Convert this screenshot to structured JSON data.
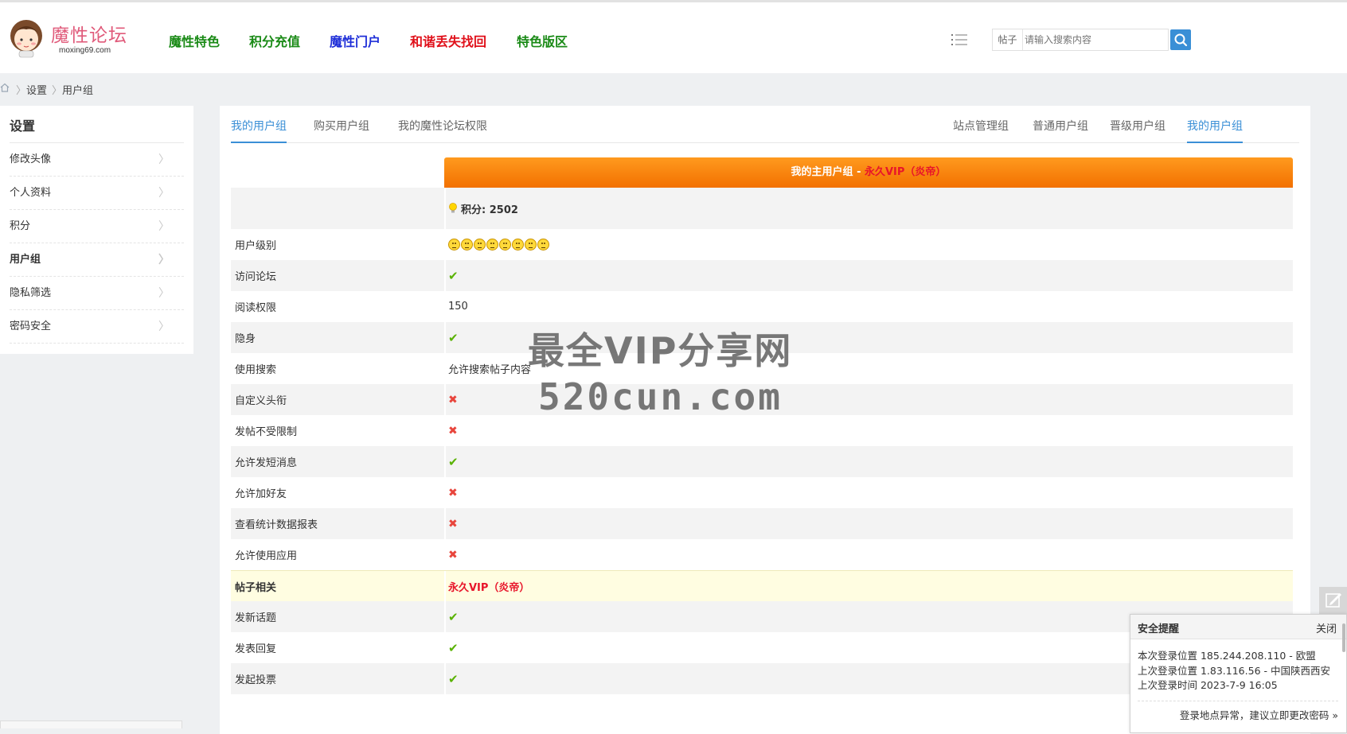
{
  "header": {
    "logo_text": "魔性论坛",
    "logo_domain": "moxing69.com",
    "nav": [
      {
        "label": "魔性特色",
        "color": "#1a8a16"
      },
      {
        "label": "积分充值",
        "color": "#1a8a16"
      },
      {
        "label": "魔性门户",
        "color": "#1f2fd8"
      },
      {
        "label": "和谐丢失找回",
        "color": "#e0101a"
      },
      {
        "label": "特色版区",
        "color": "#1a8a16"
      }
    ],
    "search": {
      "type": "帖子",
      "placeholder": "请输入搜索内容"
    }
  },
  "breadcrumb": {
    "items": [
      "设置",
      "用户组"
    ]
  },
  "sidebar": {
    "title": "设置",
    "items": [
      {
        "label": "修改头像"
      },
      {
        "label": "个人资料"
      },
      {
        "label": "积分"
      },
      {
        "label": "用户组",
        "active": true
      },
      {
        "label": "隐私筛选"
      },
      {
        "label": "密码安全"
      }
    ]
  },
  "tabs": {
    "left": [
      "我的用户组",
      "购买用户组",
      "我的魔性论坛权限"
    ],
    "right": [
      "站点管理组",
      "普通用户组",
      "晋级用户组",
      "我的用户组"
    ]
  },
  "group": {
    "head_prefix": "我的主用户组 - ",
    "head_group": "永久VIP（炎帝）",
    "points_label": "积分: 2502",
    "rows": [
      {
        "label": "用户级别",
        "type": "faces",
        "count": 8
      },
      {
        "label": "访问论坛",
        "type": "yes"
      },
      {
        "label": "阅读权限",
        "type": "text",
        "value": "150"
      },
      {
        "label": "隐身",
        "type": "yes"
      },
      {
        "label": "使用搜索",
        "type": "text",
        "value": "允许搜索帖子内容"
      },
      {
        "label": "自定义头衔",
        "type": "no"
      },
      {
        "label": "发帖不受限制",
        "type": "no"
      },
      {
        "label": "允许发短消息",
        "type": "yes"
      },
      {
        "label": "允许加好友",
        "type": "no"
      },
      {
        "label": "查看统计数据报表",
        "type": "no"
      },
      {
        "label": "允许使用应用",
        "type": "no"
      },
      {
        "label": "帖子相关",
        "type": "section",
        "value": "永久VIP（炎帝）"
      },
      {
        "label": "发新话题",
        "type": "yes"
      },
      {
        "label": "发表回复",
        "type": "yes"
      },
      {
        "label": "发起投票",
        "type": "yes"
      }
    ]
  },
  "watermark": {
    "line1": "最全VIP分享网",
    "line2": "520cun.com"
  },
  "security": {
    "title": "安全提醒",
    "close": "关闭",
    "lines": [
      "本次登录位置 185.244.208.110 - 欧盟",
      "上次登录位置 1.83.116.56 - 中国陕西西安",
      "上次登录时间 2023-7-9 16:05"
    ],
    "link": "登录地点异常，建议立即更改密码 »"
  },
  "colors": {
    "accent": "#3a8fd6",
    "orange": "#f58a0e",
    "vip_red": "#e8152a",
    "check": "#59b200",
    "cross": "#e8453c"
  }
}
